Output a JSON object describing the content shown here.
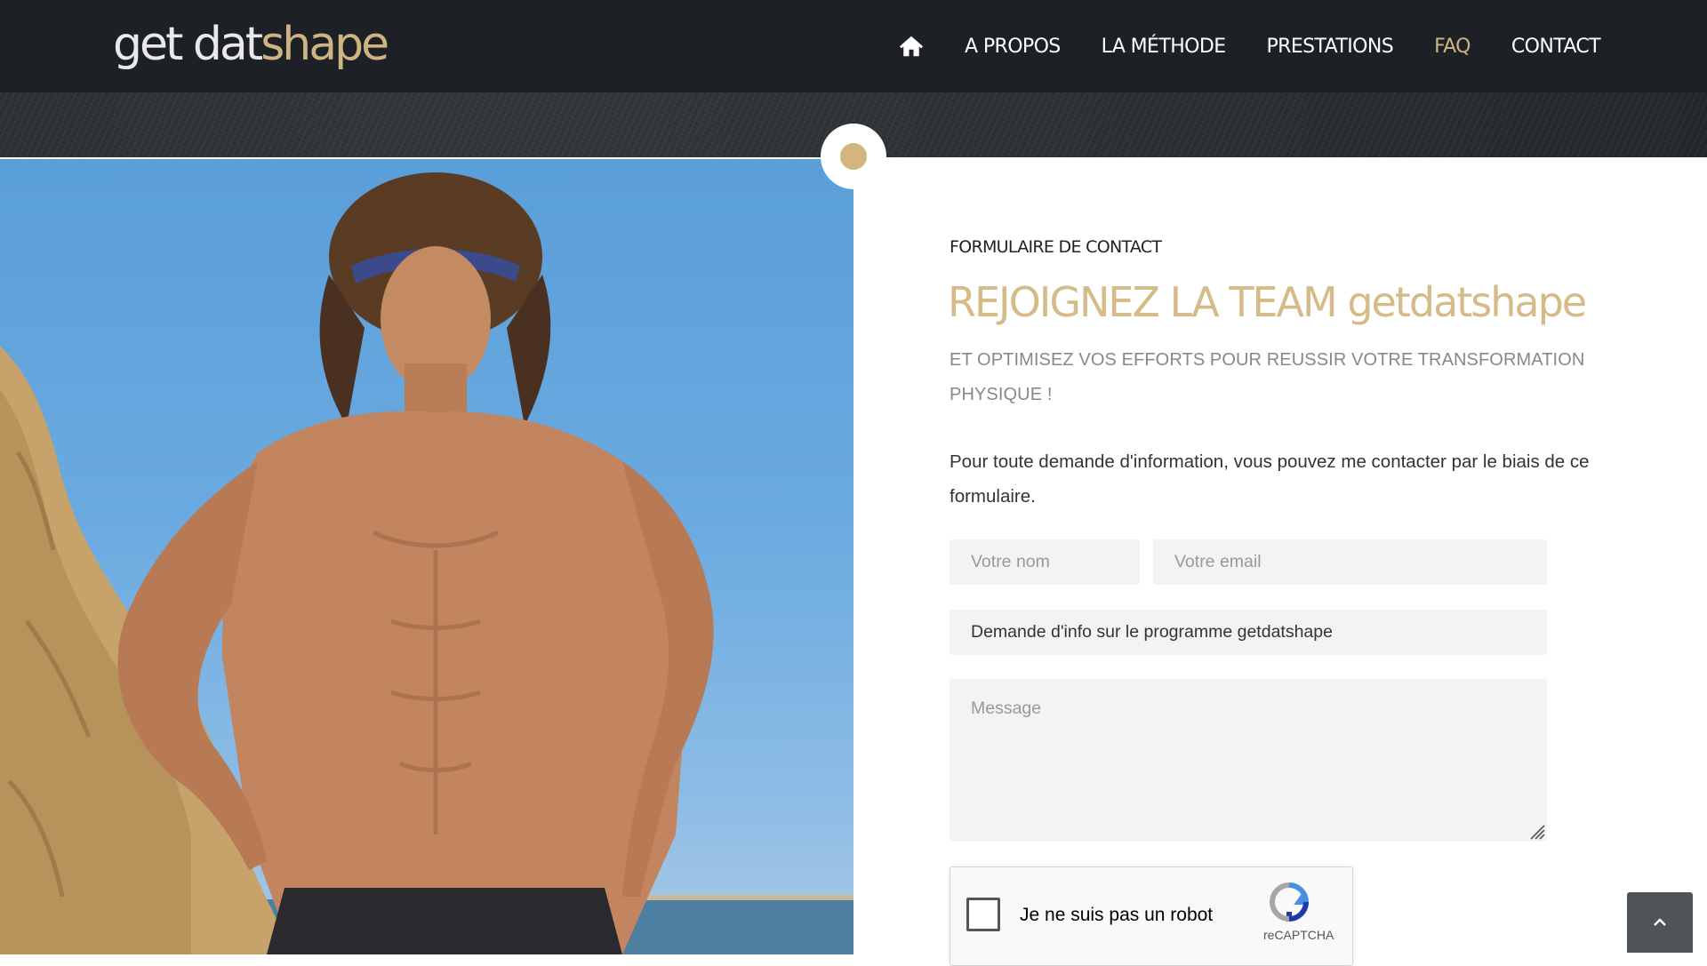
{
  "brand": {
    "logo_part1": "get dat",
    "logo_part2": "shape"
  },
  "nav": {
    "home_icon": "home-icon",
    "items": [
      {
        "label": "A PROPOS",
        "active": false
      },
      {
        "label": "LA MÉTHODE",
        "active": false
      },
      {
        "label": "PRESTATIONS",
        "active": false
      },
      {
        "label": "FAQ",
        "active": true
      },
      {
        "label": "CONTACT",
        "active": false
      }
    ]
  },
  "colors": {
    "accent": "#cdb482",
    "header_bg": "#1d2126"
  },
  "contact": {
    "section_label": "FORMULAIRE DE CONTACT",
    "heading": "REJOIGNEZ LA TEAM getdatshape",
    "subheading": "ET OPTIMISEZ VOS EFFORTS POUR REUSSIR VOTRE TRANSFORMATION PHYSIQUE !",
    "intro": "Pour toute demande d'information, vous pouvez me contacter par le biais de ce formulaire.",
    "form": {
      "name_placeholder": "Votre nom",
      "email_placeholder": "Votre email",
      "subject_value": "Demande d'info sur le programme getdatshape",
      "message_placeholder": "Message"
    },
    "captcha": {
      "label": "Je ne suis pas un robot",
      "brand": "reCAPTCHA"
    }
  },
  "scroll_top_icon": "chevron-up-icon"
}
